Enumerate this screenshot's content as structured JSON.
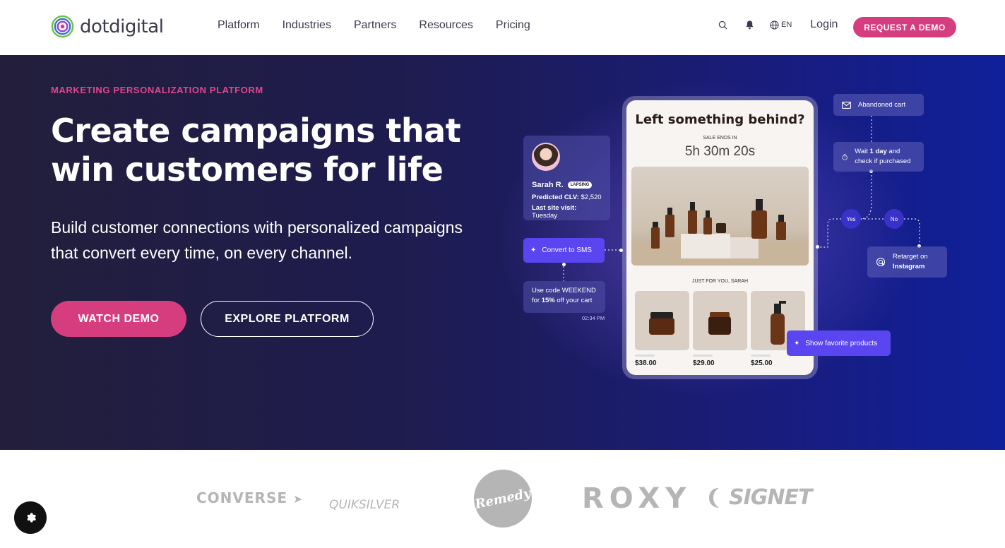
{
  "header": {
    "logo_text": "dotdigital",
    "nav": [
      "Platform",
      "Industries",
      "Partners",
      "Resources",
      "Pricing"
    ],
    "icons": [
      "search-icon",
      "bell-icon",
      "globe-icon"
    ],
    "lang": "EN",
    "login": "Login",
    "cta": "REQUEST A DEMO"
  },
  "hero": {
    "eyebrow": "MARKETING PERSONALIZATION PLATFORM",
    "headline": "Create campaigns that win customers for life",
    "subtext": "Build customer connections with personalized campaigns that convert every time, on every channel.",
    "watch_demo": "WATCH DEMO",
    "explore": "EXPLORE PLATFORM"
  },
  "illustration": {
    "profile": {
      "name": "Sarah R.",
      "tag": "LAPSING",
      "clv_label": "Predicted CLV:",
      "clv_value": "$2,520",
      "visit_label": "Last site visit:",
      "visit_value": "Tuesday"
    },
    "sms_button": "Convert to SMS",
    "weekend_pre": "Use code WEEKEND for ",
    "weekend_bold": "15%",
    "weekend_post": " off your cart",
    "time": "02:34 PM",
    "phone": {
      "title": "Left something behind?",
      "sale_label": "SALE ENDS IN",
      "timer": "5h 30m 20s",
      "just_for_you": "JUST FOR YOU, SARAH",
      "prices": [
        "$38.00",
        "$29.00",
        "$25.00"
      ]
    },
    "flow": {
      "abandoned": "Abandoned cart",
      "wait_pre": "Wait ",
      "wait_bold": "1 day",
      "wait_post": " and check if purchased",
      "yes": "Yes",
      "no": "No",
      "retarget_pre": "Retarget on",
      "retarget_bold": "Instagram"
    },
    "fav_button": "Show favorite products"
  },
  "logos": {
    "items": [
      "CONVERSE",
      "QUIKSILVER",
      "Remedy",
      "ROXY",
      "SIGNET"
    ]
  },
  "colors": {
    "accent": "#d63d7f",
    "hero_dark": "#231e3b",
    "hero_blue": "#10209a",
    "button_violet": "#5a46f0"
  }
}
